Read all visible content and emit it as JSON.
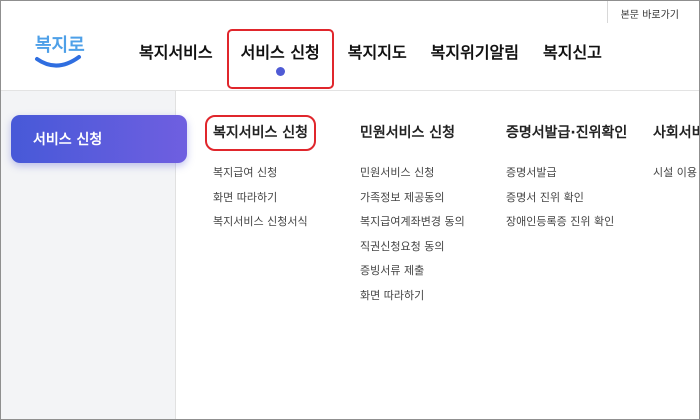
{
  "header": {
    "skip_link": "본문 바로가기",
    "logo_text": "복지로",
    "nav": [
      "복지서비스",
      "서비스 신청",
      "복지지도",
      "복지위기알림",
      "복지신고"
    ]
  },
  "side": {
    "active_tab": "서비스 신청"
  },
  "menu": {
    "columns": [
      {
        "title": "복지서비스 신청",
        "items": [
          "복지급여 신청",
          "화면 따라하기",
          "복지서비스 신청서식"
        ]
      },
      {
        "title": "민원서비스 신청",
        "items": [
          "민원서비스 신청",
          "가족정보 제공동의",
          "복지급여계좌변경 동의",
          "직권신청요청 동의",
          "증빙서류 제출",
          "화면 따라하기"
        ]
      },
      {
        "title": "증명서발급·진위확인",
        "items": [
          "증명서발급",
          "증명서 진위 확인",
          "장애인등록증 진위 확인"
        ]
      },
      {
        "title": "사회서비",
        "items": [
          "시설 이용"
        ]
      }
    ]
  },
  "colors": {
    "accent": "#4f5bd5",
    "highlight_box": "#e0262c",
    "side_bg": "#f3f4f6"
  }
}
